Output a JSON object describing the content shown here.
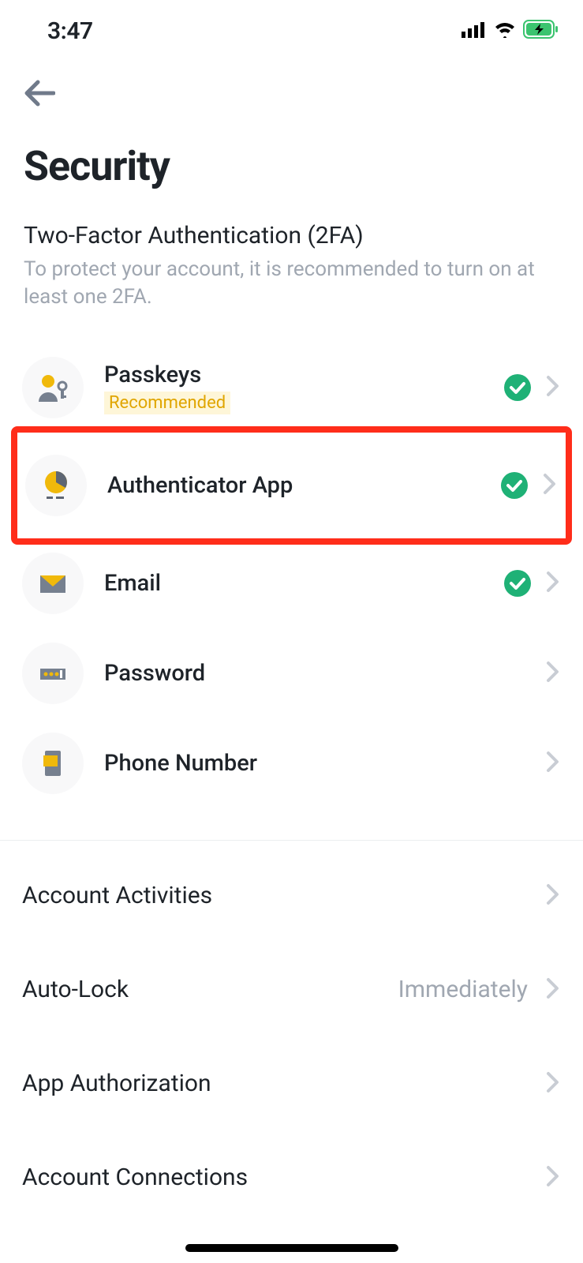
{
  "status": {
    "time": "3:47"
  },
  "page": {
    "title": "Security"
  },
  "two_fa": {
    "section_title": "Two-Factor Authentication (2FA)",
    "section_desc": "To protect your account, it is recommended to turn on at least one 2FA.",
    "items": [
      {
        "label": "Passkeys",
        "badge": "Recommended",
        "enabled": true
      },
      {
        "label": "Authenticator App",
        "enabled": true,
        "highlighted": true
      },
      {
        "label": "Email",
        "enabled": true
      },
      {
        "label": "Password",
        "enabled": false
      },
      {
        "label": "Phone Number",
        "enabled": false
      }
    ]
  },
  "settings": [
    {
      "label": "Account Activities",
      "value": ""
    },
    {
      "label": "Auto-Lock",
      "value": "Immediately"
    },
    {
      "label": "App Authorization",
      "value": ""
    },
    {
      "label": "Account Connections",
      "value": ""
    }
  ]
}
